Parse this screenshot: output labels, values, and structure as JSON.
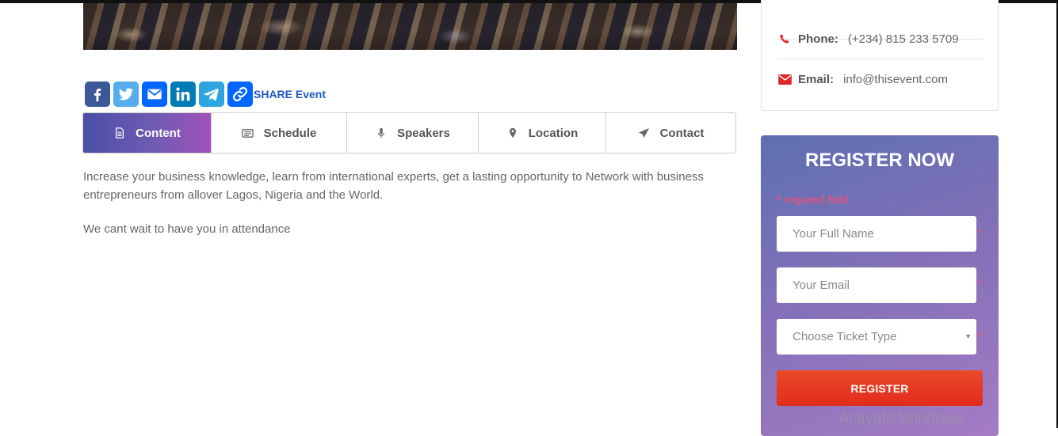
{
  "share": {
    "label": "SHARE Event",
    "buttons": [
      {
        "name": "facebook",
        "icon": "facebook-icon",
        "color": "#3b5998"
      },
      {
        "name": "twitter",
        "icon": "twitter-icon",
        "color": "#55acee"
      },
      {
        "name": "email",
        "icon": "email-icon",
        "color": "#0166ff"
      },
      {
        "name": "linkedin",
        "icon": "linkedin-icon",
        "color": "#007bb5"
      },
      {
        "name": "telegram",
        "icon": "telegram-icon",
        "color": "#2ca5e0"
      },
      {
        "name": "copy-link",
        "icon": "link-icon",
        "color": "#0166ff"
      }
    ]
  },
  "tabs": [
    {
      "label": "Content",
      "icon": "document-icon",
      "active": true
    },
    {
      "label": "Schedule",
      "icon": "list-icon",
      "active": false
    },
    {
      "label": "Speakers",
      "icon": "microphone-icon",
      "active": false
    },
    {
      "label": "Location",
      "icon": "map-pin-icon",
      "active": false
    },
    {
      "label": "Contact",
      "icon": "paper-plane-icon",
      "active": false
    }
  ],
  "content": {
    "paragraph1": "Increase your business knowledge, learn from international experts, get a lasting opportunity to Network with business entrepreneurs from allover Lagos, Nigeria and the World.",
    "paragraph2": "We cant wait to have you in attendance"
  },
  "contact": {
    "phone_label": "Phone:",
    "phone": "(+234) 815 233 5709",
    "email_label": "Email:",
    "email": "info@thisevent.com",
    "accent_color": "#e0262b"
  },
  "register": {
    "title": "REGISTER NOW",
    "required_note": "* required field.",
    "name_placeholder": "Your Full Name",
    "email_placeholder": "Your Email",
    "ticket_placeholder": "Choose Ticket Type",
    "required_marker": "*",
    "button_label": "REGISTER",
    "button_color": "#e53a22"
  },
  "watermark": "Activate Windows"
}
